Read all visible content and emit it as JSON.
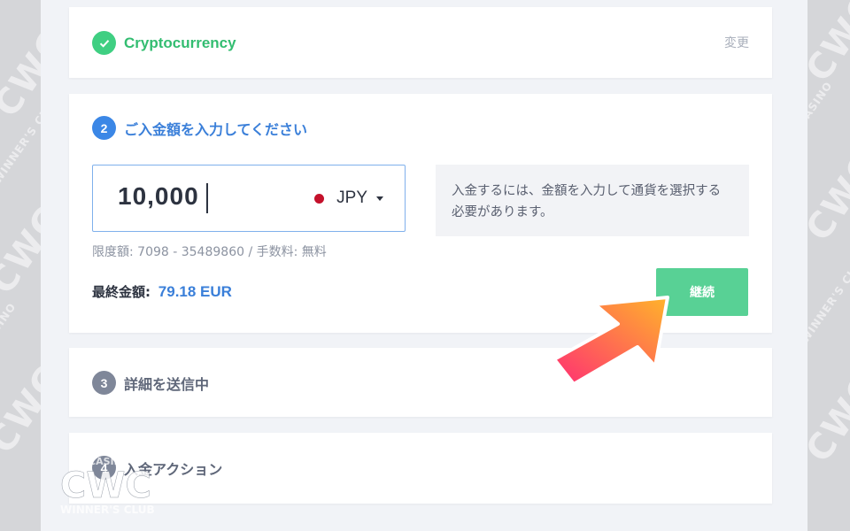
{
  "steps": {
    "step1": {
      "title": "Cryptocurrency",
      "action": "変更"
    },
    "step2": {
      "number": "2",
      "title": "ご入金額を入力してください"
    },
    "step3": {
      "number": "3",
      "title": "詳細を送信中"
    },
    "step4": {
      "number": "4",
      "title": "入金アクション"
    }
  },
  "deposit": {
    "amount": "10,000",
    "currency": "JPY",
    "info": "入金するには、金額を入力して通貨を選択する必要があります。",
    "limits": "限度額: 7098 - 35489860 / 手数料: 無料",
    "final_label": "最終金額:",
    "final_value": "79.18 EUR",
    "continue_label": "継続"
  },
  "watermark": {
    "logo_top": "CASINO",
    "logo_main": "CWC",
    "logo_bottom": "WINNER'S CLUB"
  },
  "colors": {
    "success": "#3fcf82",
    "active": "#3b87e6",
    "pending": "#7f8799",
    "button": "#58d195",
    "arrow_start": "#ffb42a",
    "arrow_end": "#ff2f73"
  }
}
